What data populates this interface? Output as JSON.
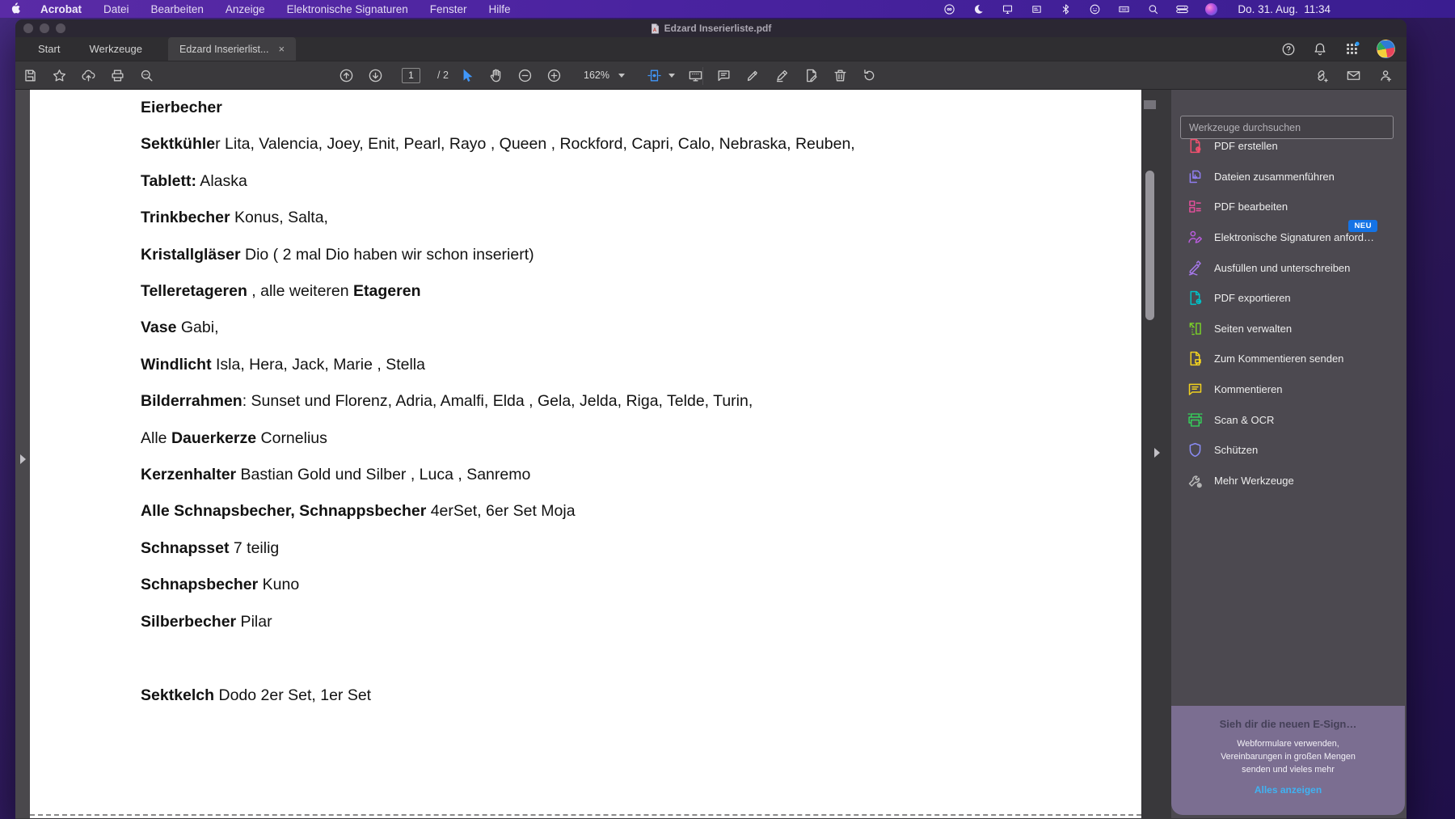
{
  "colors": {
    "toolbar_icon": "#c7c7c7",
    "accent_blue": "#4097fa",
    "menubar_icon": "#efeafa",
    "badge_blue": "#1473e6"
  },
  "menubar": {
    "items": [
      "Acrobat",
      "Datei",
      "Bearbeiten",
      "Anzeige",
      "Elektronische Signaturen",
      "Fenster",
      "Hilfe"
    ],
    "status_icons": [
      "creative-cloud-icon",
      "moon-icon",
      "display-icon",
      "input-source-icon",
      "bluetooth-icon",
      "face-circle-icon",
      "keyboard-icon",
      "spotlight-icon",
      "control-center-icon",
      "siri-icon"
    ],
    "clock": "Do. 31. Aug.  11:34"
  },
  "window": {
    "title": "Edzard Inserierliste.pdf",
    "tabs": {
      "start": "Start",
      "tools": "Werkzeuge",
      "doc": "Edzard Inserierlist...",
      "close": "×"
    },
    "tab_right_icons": [
      "help-icon",
      "bell-icon",
      "app-grid-icon"
    ],
    "toolbar": {
      "file_icons": [
        "save",
        "star",
        "cloud-upload",
        "print",
        "search"
      ],
      "nav_icons": [
        "arrow-up-circle",
        "arrow-down-circle"
      ],
      "page_current": "1",
      "page_total": "/ 2",
      "view_icons": [
        "select-cursor",
        "hand",
        "zoom-out",
        "zoom-in"
      ],
      "zoom_level": "162%",
      "fit_icons": [
        "fit-width",
        "presentation"
      ],
      "annot_icons": [
        "comment",
        "highlighter",
        "sign-pen",
        "edit-page",
        "trash",
        "rotate-pages"
      ],
      "share_icons": [
        "share-link",
        "send-mail",
        "person-add"
      ]
    }
  },
  "document": {
    "lines": [
      {
        "segments": [
          {
            "t": "Eierbecher",
            "b": 1
          }
        ]
      },
      {
        "segments": [
          {
            "t": "Sektkühle",
            "b": 1
          },
          {
            "t": "r Lita, Valencia, Joey, Enit, Pearl, Rayo , Queen , Rockford, Capri, Calo, Nebraska, Reuben,",
            "b": 0
          }
        ]
      },
      {
        "segments": [
          {
            "t": "Tablett:",
            "b": 1
          },
          {
            "t": " Alaska",
            "b": 0
          }
        ]
      },
      {
        "segments": [
          {
            "t": "Trinkbecher",
            "b": 1
          },
          {
            "t": " Konus, Salta,",
            "b": 0
          }
        ]
      },
      {
        "segments": [
          {
            "t": "Kristallgläser",
            "b": 1
          },
          {
            "t": " Dio ( 2 mal  Dio haben wir schon inseriert)",
            "b": 0
          }
        ]
      },
      {
        "segments": [
          {
            "t": "Telleretageren",
            "b": 1
          },
          {
            "t": " , alle weiteren ",
            "b": 0
          },
          {
            "t": "Etageren",
            "b": 1
          }
        ]
      },
      {
        "segments": [
          {
            "t": "Vase",
            "b": 1
          },
          {
            "t": " Gabi,",
            "b": 0
          }
        ]
      },
      {
        "segments": [
          {
            "t": "Windlicht",
            "b": 1
          },
          {
            "t": " Isla, Hera, Jack, Marie , Stella",
            "b": 0
          }
        ]
      },
      {
        "segments": [
          {
            "t": "Bilderrahmen",
            "b": 1
          },
          {
            "t": ": Sunset und Florenz, Adria, Amalfi, Elda , Gela, Jelda, Riga, Telde, Turin,",
            "b": 0
          }
        ]
      },
      {
        "segments": [
          {
            "t": "Alle ",
            "b": 0
          },
          {
            "t": "Dauerkerze",
            "b": 1
          },
          {
            "t": " Cornelius",
            "b": 0
          }
        ]
      },
      {
        "segments": [
          {
            "t": "Kerzenhalter",
            "b": 1
          },
          {
            "t": " Bastian Gold und Silber , Luca , Sanremo",
            "b": 0
          }
        ]
      },
      {
        "segments": [
          {
            "t": "Alle Schnapsbecher, Schnappsbecher",
            "b": 1
          },
          {
            "t": " 4erSet, 6er Set Moja",
            "b": 0
          }
        ]
      },
      {
        "segments": [
          {
            "t": "Schnapsset",
            "b": 1
          },
          {
            "t": " 7 teilig",
            "b": 0
          }
        ]
      },
      {
        "segments": [
          {
            "t": "Schnapsbecher",
            "b": 1
          },
          {
            "t": " Kuno",
            "b": 0
          }
        ]
      },
      {
        "segments": [
          {
            "t": "Silberbecher",
            "b": 1
          },
          {
            "t": " Pilar",
            "b": 0
          }
        ]
      },
      {
        "segments": []
      },
      {
        "segments": [
          {
            "t": "Sektkelch",
            "b": 1
          },
          {
            "t": " Dodo 2er Set, 1er Set",
            "b": 0
          }
        ]
      }
    ]
  },
  "sidebar": {
    "search_placeholder": "Werkzeuge durchsuchen",
    "tools": [
      {
        "label": "PDF erstellen",
        "icon": "doc-plus",
        "color": "#f0506e"
      },
      {
        "label": "Dateien zusammenführen",
        "icon": "docs-merge",
        "color": "#8f7df0"
      },
      {
        "label": "PDF bearbeiten",
        "icon": "layout-edit",
        "color": "#e8509e"
      },
      {
        "label": "Elektronische Signaturen anford…",
        "icon": "person-pen",
        "color": "#b95cdd",
        "badge": "NEU"
      },
      {
        "label": "Ausfüllen und unterschreiben",
        "icon": "pen-squiggle",
        "color": "#a678ea"
      },
      {
        "label": "PDF exportieren",
        "icon": "doc-export",
        "color": "#00c2c7"
      },
      {
        "label": "Seiten verwalten",
        "icon": "pages-manage",
        "color": "#79d028"
      },
      {
        "label": "Zum Kommentieren senden",
        "icon": "doc-comment",
        "color": "#f2d21f"
      },
      {
        "label": "Kommentieren",
        "icon": "comment-lines",
        "color": "#f2d21f"
      },
      {
        "label": "Scan & OCR",
        "icon": "scan",
        "color": "#35d05a"
      },
      {
        "label": "Schützen",
        "icon": "shield",
        "color": "#8a8cf5"
      },
      {
        "label": "Mehr Werkzeuge",
        "icon": "wrench-plus",
        "color": "#b9b9b9"
      }
    ],
    "promo": {
      "title": "Sieh dir die neuen E-Sign…",
      "body_lines": [
        "Webformulare verwenden,",
        "Vereinbarungen in großen Mengen",
        "senden und vieles mehr"
      ],
      "link": "Alles anzeigen"
    }
  }
}
